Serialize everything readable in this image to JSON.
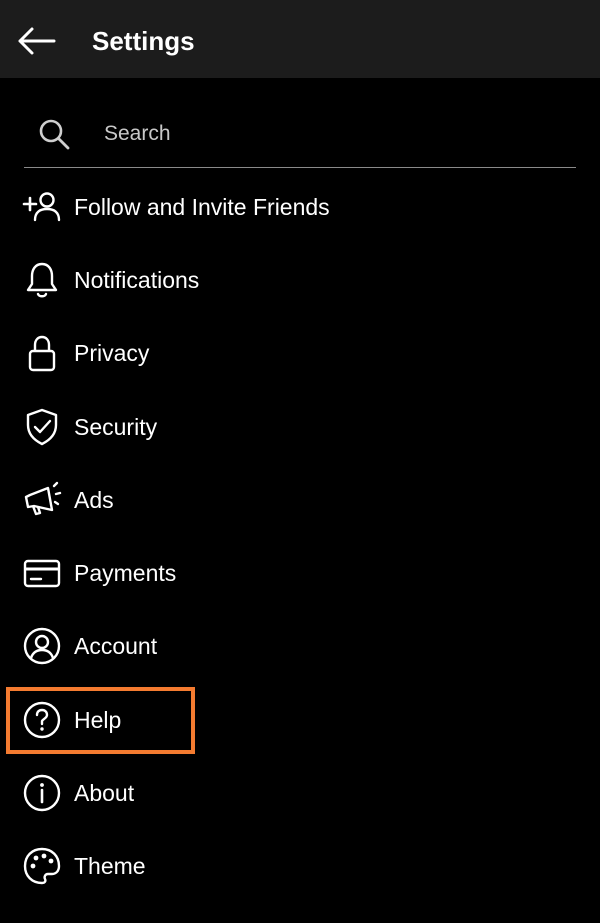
{
  "header": {
    "title": "Settings",
    "back_icon": "arrow-left-icon"
  },
  "search": {
    "placeholder": "Search",
    "icon": "search-icon"
  },
  "menu": {
    "items": [
      {
        "label": "Follow and Invite Friends",
        "icon": "add-person-icon"
      },
      {
        "label": "Notifications",
        "icon": "bell-icon"
      },
      {
        "label": "Privacy",
        "icon": "lock-icon"
      },
      {
        "label": "Security",
        "icon": "shield-check-icon"
      },
      {
        "label": "Ads",
        "icon": "megaphone-icon"
      },
      {
        "label": "Payments",
        "icon": "credit-card-icon"
      },
      {
        "label": "Account",
        "icon": "account-circle-icon"
      },
      {
        "label": "Help",
        "icon": "help-circle-icon"
      },
      {
        "label": "About",
        "icon": "info-circle-icon"
      },
      {
        "label": "Theme",
        "icon": "palette-icon"
      }
    ]
  },
  "highlight": {
    "target": "Help",
    "color": "#f47b30"
  },
  "colors": {
    "background": "#000000",
    "header_background": "#1c1c1c",
    "text": "#ffffff",
    "divider": "#8a8a8a"
  }
}
